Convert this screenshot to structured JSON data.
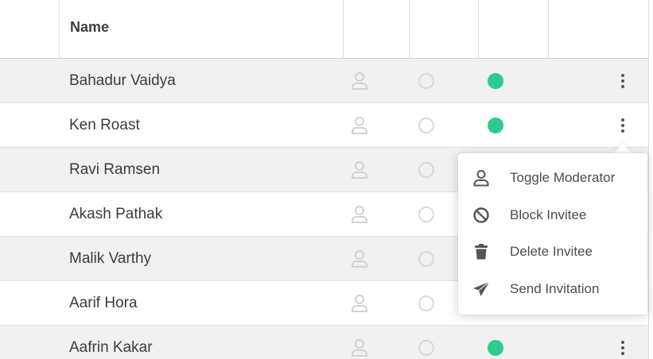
{
  "table": {
    "header": {
      "name": "Name"
    },
    "rows": [
      {
        "name": "Bahadur Vaidya",
        "online": true
      },
      {
        "name": "Ken Roast",
        "online": true
      },
      {
        "name": "Ravi Ramsen",
        "online": false
      },
      {
        "name": "Akash Pathak",
        "online": false
      },
      {
        "name": "Malik Varthy",
        "online": false
      },
      {
        "name": "Aarif Hora",
        "online": false
      },
      {
        "name": "Aafrin Kakar",
        "online": true
      }
    ]
  },
  "menu": {
    "items": [
      {
        "label": "Toggle Moderator",
        "icon": "user-icon"
      },
      {
        "label": "Block Invitee",
        "icon": "block-icon"
      },
      {
        "label": "Delete Invitee",
        "icon": "trash-icon"
      },
      {
        "label": "Send Invitation",
        "icon": "send-icon"
      }
    ]
  },
  "colors": {
    "online": "#2ecc8a",
    "stripe": "#f1f1f1",
    "icon_muted": "#d2d2d2"
  }
}
